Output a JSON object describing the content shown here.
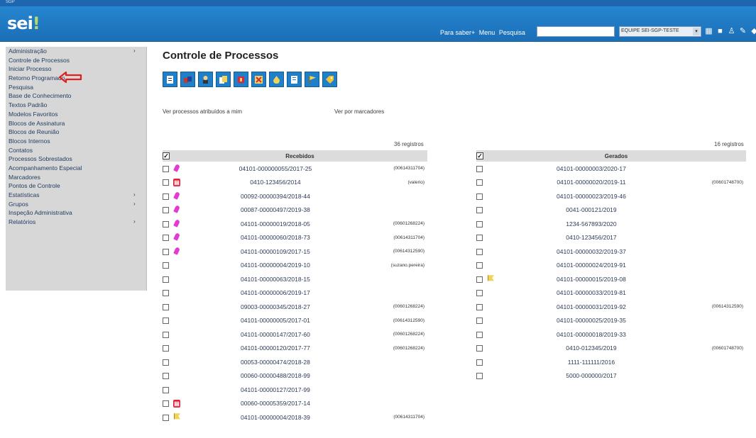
{
  "topbar": {
    "system_label": "SGP"
  },
  "header": {
    "logo_text": "sei",
    "logo_mark": "!",
    "links": [
      "Para saber+",
      "Menu",
      "Pesquisa"
    ],
    "search_value": "",
    "unit_select": "EQUIPE SEI-SGP-TESTE",
    "icons": [
      "grid-icon",
      "stop-icon",
      "user-icon",
      "pencil-icon",
      "tag-icon"
    ]
  },
  "menu": {
    "items": [
      {
        "label": "Administração",
        "submenu": true
      },
      {
        "label": "Controle de Processos",
        "submenu": false
      },
      {
        "label": "Iniciar Processo",
        "submenu": false
      },
      {
        "label": "Retorno Programado",
        "submenu": false
      },
      {
        "label": "Pesquisa",
        "submenu": false
      },
      {
        "label": "Base de Conhecimento",
        "submenu": false
      },
      {
        "label": "Textos Padrão",
        "submenu": false
      },
      {
        "label": "Modelos Favoritos",
        "submenu": false
      },
      {
        "label": "Blocos de Assinatura",
        "submenu": false
      },
      {
        "label": "Blocos de Reunião",
        "submenu": false
      },
      {
        "label": "Blocos Internos",
        "submenu": false
      },
      {
        "label": "Contatos",
        "submenu": false
      },
      {
        "label": "Processos Sobrestados",
        "submenu": false
      },
      {
        "label": "Acompanhamento Especial",
        "submenu": false
      },
      {
        "label": "Marcadores",
        "submenu": false
      },
      {
        "label": "Pontos de Controle",
        "submenu": false
      },
      {
        "label": "Estatísticas",
        "submenu": true
      },
      {
        "label": "Grupos",
        "submenu": true
      },
      {
        "label": "Inspeção Administrativa",
        "submenu": false
      },
      {
        "label": "Relatórios",
        "submenu": true
      }
    ],
    "highlight_arrow_color": "#e02020"
  },
  "page": {
    "title": "Controle de Processos",
    "toolbar_icons": [
      "new-process-icon",
      "send-process-icon",
      "assign-user-icon",
      "documents-icon",
      "close-process-icon",
      "tools-icon",
      "sign-icon",
      "note-icon",
      "flag-icon",
      "tag-icon"
    ],
    "link_assigned": "Ver processos atribuídos a mim",
    "link_markers": "Ver por marcadores"
  },
  "received": {
    "count_label": "36 registros",
    "header": "Recebidos",
    "rows": [
      {
        "icon": "pin",
        "number": "04101-000000055/2017-25",
        "user": "(00614311704)"
      },
      {
        "icon": "red",
        "number": "0410-123456/2014",
        "user": "(valerio)"
      },
      {
        "icon": "pin",
        "number": "00092-00000394/2018-44",
        "user": ""
      },
      {
        "icon": "pin",
        "number": "00087-00000497/2019-38",
        "user": ""
      },
      {
        "icon": "pin",
        "number": "04101-00000019/2018-05",
        "user": "(00601268224)"
      },
      {
        "icon": "pin",
        "number": "04101-00000060/2018-73",
        "user": "(00614311704)"
      },
      {
        "icon": "pin",
        "number": "04101-00000109/2017-15",
        "user": "(00614312590)"
      },
      {
        "icon": "",
        "number": "04101-00000004/2019-10",
        "user": "(suzano.pereira)"
      },
      {
        "icon": "",
        "number": "04101-00000063/2018-15",
        "user": ""
      },
      {
        "icon": "",
        "number": "04101-00000006/2019-17",
        "user": ""
      },
      {
        "icon": "",
        "number": "09003-00000345/2018-27",
        "user": "(00601268224)"
      },
      {
        "icon": "",
        "number": "04101-00000005/2017-01",
        "user": "(00614312590)"
      },
      {
        "icon": "",
        "number": "04101-00000147/2017-60",
        "user": "(00601268224)"
      },
      {
        "icon": "",
        "number": "04101-00000120/2017-77",
        "user": "(00601268224)"
      },
      {
        "icon": "",
        "number": "00053-00000474/2018-28",
        "user": ""
      },
      {
        "icon": "",
        "number": "00060-00000488/2018-99",
        "user": ""
      },
      {
        "icon": "",
        "number": "04101-00000127/2017-99",
        "user": ""
      },
      {
        "icon": "red",
        "number": "00060-00005359/2017-14",
        "user": ""
      },
      {
        "icon": "flag",
        "number": "04101-00000004/2018-39",
        "user": "(00614311704)"
      }
    ]
  },
  "generated": {
    "count_label": "16 registros",
    "header": "Gerados",
    "rows": [
      {
        "icon": "",
        "number": "04101-00000003/2020-17",
        "user": ""
      },
      {
        "icon": "",
        "number": "04101-00000020/2019-11",
        "user": "(00601748700)"
      },
      {
        "icon": "",
        "number": "04101-00000023/2019-46",
        "user": ""
      },
      {
        "icon": "",
        "number": "0041-000121/2019",
        "user": ""
      },
      {
        "icon": "",
        "number": "1234-567893/2020",
        "user": ""
      },
      {
        "icon": "",
        "number": "0410-123456/2017",
        "user": ""
      },
      {
        "icon": "",
        "number": "04101-00000032/2019-37",
        "user": ""
      },
      {
        "icon": "",
        "number": "04101-00000024/2019-91",
        "user": ""
      },
      {
        "icon": "flag",
        "number": "04101-00000015/2019-08",
        "user": ""
      },
      {
        "icon": "",
        "number": "04101-00000033/2019-81",
        "user": ""
      },
      {
        "icon": "",
        "number": "04101-00000031/2019-92",
        "user": "(00614312590)"
      },
      {
        "icon": "",
        "number": "04101-00000025/2019-35",
        "user": ""
      },
      {
        "icon": "",
        "number": "04101-00000018/2019-33",
        "user": ""
      },
      {
        "icon": "",
        "number": "0410-012345/2019",
        "user": "(00601748700)"
      },
      {
        "icon": "",
        "number": "1111-111111/2016",
        "user": ""
      },
      {
        "icon": "",
        "number": "5000-000000/2017",
        "user": ""
      }
    ]
  },
  "colors": {
    "header_blue": "#1f77c2",
    "toolbar_blue": "#1f7fc9",
    "menu_gray": "#d7d7d7",
    "pin_magenta": "#e23ad3",
    "alert_red": "#e0243a",
    "flag_yellow": "#f2d35a"
  }
}
